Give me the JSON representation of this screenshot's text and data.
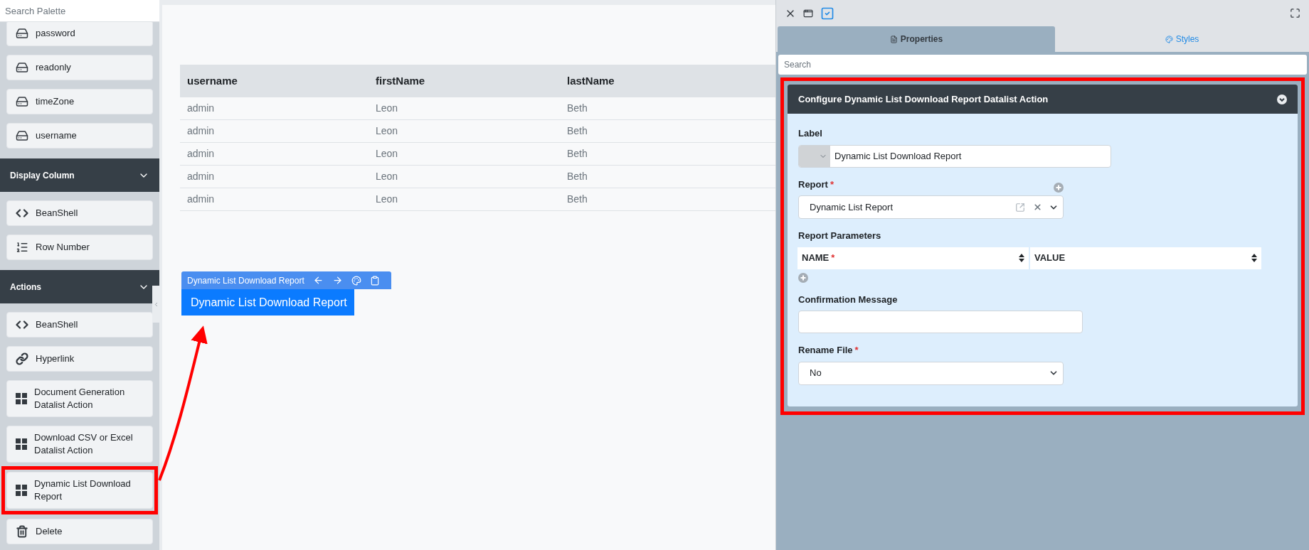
{
  "palette": {
    "search_placeholder": "Search Palette",
    "entries": [
      {
        "kind": "field",
        "label": "password",
        "highlighted": false
      },
      {
        "kind": "field",
        "label": "readonly",
        "highlighted": false
      },
      {
        "kind": "field",
        "label": "timeZone",
        "highlighted": false
      },
      {
        "kind": "field",
        "label": "username",
        "highlighted": false
      },
      {
        "kind": "section",
        "label": "Display Column",
        "highlighted": false
      },
      {
        "kind": "code",
        "label": "BeanShell",
        "highlighted": false
      },
      {
        "kind": "numbered",
        "label": "Row Number",
        "highlighted": false
      },
      {
        "kind": "section",
        "label": "Actions",
        "highlighted": false
      },
      {
        "kind": "code",
        "label": "BeanShell",
        "highlighted": false
      },
      {
        "kind": "link",
        "label": "Hyperlink",
        "highlighted": false
      },
      {
        "kind": "grid",
        "label": "Document Generation Datalist Action",
        "highlighted": false
      },
      {
        "kind": "grid",
        "label": "Download CSV or Excel Datalist Action",
        "highlighted": false
      },
      {
        "kind": "grid",
        "label": "Dynamic List Download Report",
        "highlighted": true
      },
      {
        "kind": "trash",
        "label": "Delete",
        "highlighted": false
      }
    ]
  },
  "canvas": {
    "table": {
      "columns": [
        "username",
        "firstName",
        "lastName"
      ],
      "rows": [
        [
          "admin",
          "Leon",
          "Beth"
        ],
        [
          "admin",
          "Leon",
          "Beth"
        ],
        [
          "admin",
          "Leon",
          "Beth"
        ],
        [
          "admin",
          "Leon",
          "Beth"
        ],
        [
          "admin",
          "Leon",
          "Beth"
        ]
      ]
    },
    "element": {
      "toolbar_label": "Dynamic List Download Report",
      "button_label": "Dynamic List Download Report"
    }
  },
  "properties_panel": {
    "tabs": [
      {
        "label": "Properties",
        "kind": "file",
        "selected": true
      },
      {
        "label": "Styles",
        "kind": "palette",
        "selected": false
      }
    ],
    "search_placeholder": "Search",
    "card": {
      "title": "Configure Dynamic List Download Report Datalist Action",
      "fields": [
        {
          "kind": "prefixed-text",
          "label": "Label",
          "value": "Dynamic List Download Report"
        },
        {
          "kind": "report-select",
          "label": "Report",
          "required_mark": "*",
          "value": "Dynamic List Report"
        },
        {
          "kind": "grid",
          "label": "Report Parameters",
          "columns": [
            {
              "label": "NAME",
              "required_mark": "*"
            },
            {
              "label": "VALUE"
            }
          ]
        },
        {
          "kind": "text",
          "label": "Confirmation Message"
        },
        {
          "kind": "select",
          "label": "Rename File",
          "required_mark": "*",
          "value": "No"
        }
      ]
    }
  }
}
